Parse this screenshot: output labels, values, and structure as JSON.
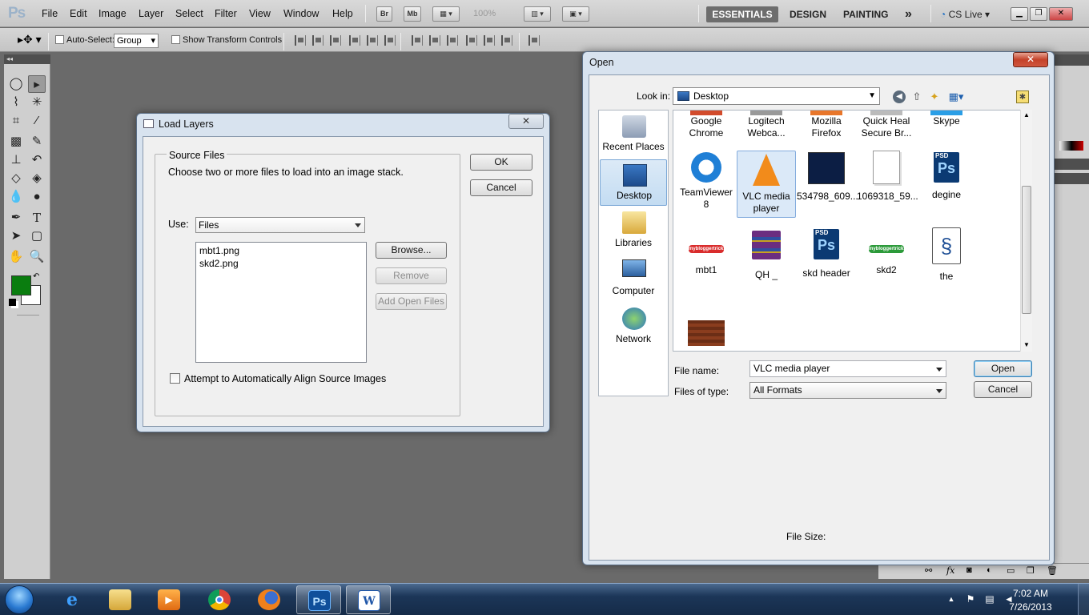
{
  "app": {
    "logo": "Ps",
    "menus": [
      "File",
      "Edit",
      "Image",
      "Layer",
      "Select",
      "Filter",
      "View",
      "Window",
      "Help"
    ],
    "bridge_label": "Br",
    "minibridge_label": "Mb",
    "zoom": "100%",
    "workspaces": [
      "ESSENTIALS",
      "DESIGN",
      "PAINTING"
    ],
    "more_label": "»",
    "cslive_label": "CS Live"
  },
  "options": {
    "auto_select_label": "Auto-Select:",
    "auto_select_value": "Group",
    "transform_label": "Show Transform Controls"
  },
  "load_layers": {
    "title": "Load Layers",
    "group_title": "Source Files",
    "instruction": "Choose two or more files to load into an image stack.",
    "use_label": "Use:",
    "use_value": "Files",
    "files": [
      "mbt1.png",
      "skd2.png"
    ],
    "browse_label": "Browse...",
    "remove_label": "Remove",
    "add_open_label": "Add Open Files",
    "align_label": "Attempt to Automatically Align Source Images",
    "ok_label": "OK",
    "cancel_label": "Cancel",
    "close_label": "✕"
  },
  "open_dialog": {
    "title": "Open",
    "look_in_label": "Look in:",
    "look_in_value": "Desktop",
    "places": [
      "Recent Places",
      "Desktop",
      "Libraries",
      "Computer",
      "Network"
    ],
    "selected_place": "Desktop",
    "top_row": [
      "Google Chrome",
      "Logitech Webca...",
      "Mozilla Firefox",
      "Quick Heal Secure Br...",
      "Skype"
    ],
    "row2": [
      "TeamViewer 8",
      "VLC media player",
      "534798_609...",
      "1069318_59...",
      "degine"
    ],
    "row3": [
      "mbt1",
      "QH _",
      "skd header",
      "skd2",
      "the"
    ],
    "selected_file": "VLC media player",
    "file_name_label": "File name:",
    "file_name_value": "VLC media player",
    "files_type_label": "Files of type:",
    "files_type_value": "All Formats",
    "open_label": "Open",
    "cancel_label": "Cancel",
    "file_size_label": "File Size:",
    "close_label": "✕"
  },
  "taskbar": {
    "time": "7:02 AM",
    "date": "7/26/2013",
    "apps": [
      "internet-explorer",
      "windows-explorer",
      "media-player",
      "chrome",
      "firefox",
      "photoshop",
      "word"
    ]
  }
}
